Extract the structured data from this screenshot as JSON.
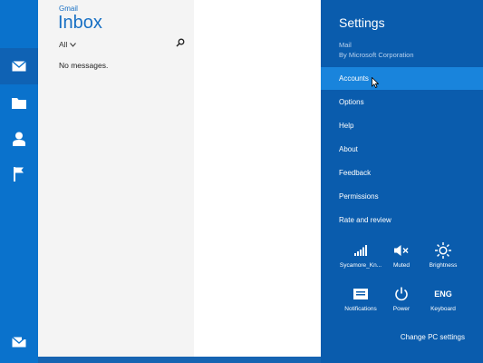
{
  "rail": {
    "items": [
      {
        "icon": "mail-icon",
        "selected": true
      },
      {
        "icon": "folder-icon",
        "selected": false
      },
      {
        "icon": "people-icon",
        "selected": false
      },
      {
        "icon": "flag-icon",
        "selected": false
      }
    ],
    "bottom_icon": "mail-compose-icon"
  },
  "folder_pane": {
    "account": "Gmail",
    "title": "Inbox",
    "filter_label": "All",
    "empty_message": "No messages."
  },
  "settings": {
    "title": "Settings",
    "app_name": "Mail",
    "publisher": "By Microsoft Corporation",
    "menu": [
      "Accounts",
      "Options",
      "Help",
      "About",
      "Feedback",
      "Permissions",
      "Rate and review"
    ],
    "hovered_item": "Accounts",
    "quick_settings": [
      {
        "icon": "network-signal-icon",
        "label": "Sycamore_Kn..."
      },
      {
        "icon": "volume-muted-icon",
        "label": "Muted"
      },
      {
        "icon": "brightness-icon",
        "label": "Brightness"
      },
      {
        "icon": "notifications-icon",
        "label": "Notifications"
      },
      {
        "icon": "power-icon",
        "label": "Power"
      },
      {
        "icon": "keyboard-icon",
        "label": "Keyboard",
        "glyph": "ENG"
      }
    ],
    "change_pc_settings": "Change PC settings"
  },
  "colors": {
    "rail": "#0a72cc",
    "settings_bg": "#0a5cad",
    "hover": "#1984dc",
    "accent_text": "#1870c4",
    "folder_bg": "#f4f4f4"
  }
}
